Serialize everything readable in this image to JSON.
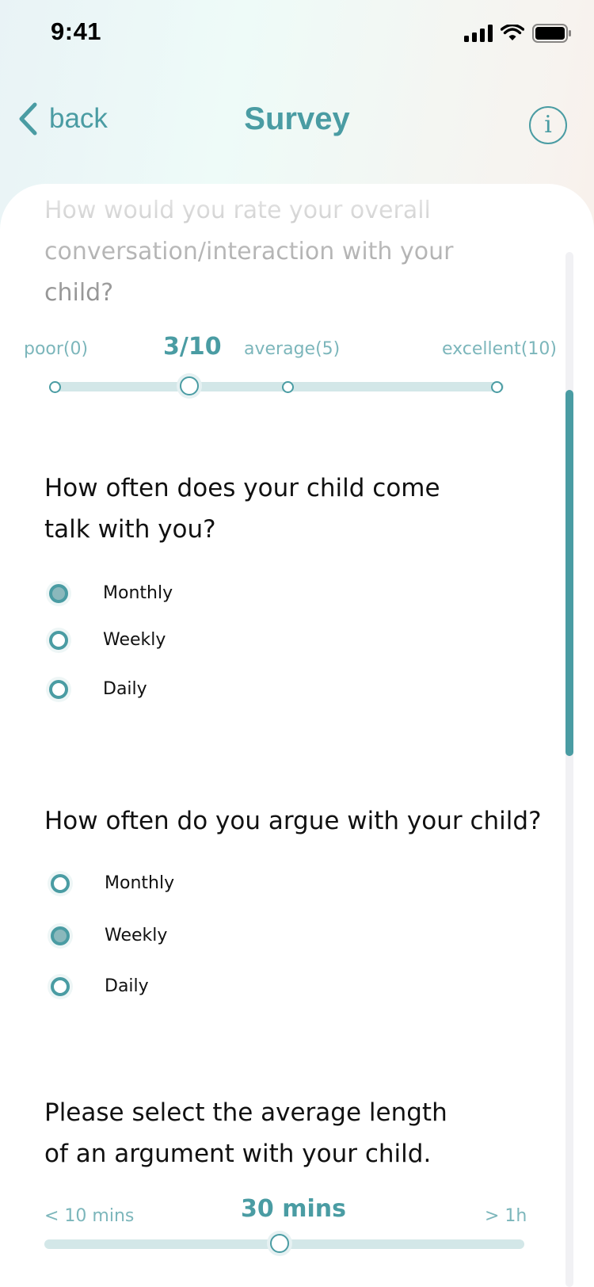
{
  "status": {
    "time": "9:41"
  },
  "nav": {
    "back_label": "back",
    "title": "Survey"
  },
  "colors": {
    "accent": "#4a9ca3",
    "track": "#d3e7e8",
    "label": "#7cb6bb"
  },
  "q1": {
    "text": "How would you rate your overall conversation/interaction with your child?",
    "labels": {
      "min": "poor(0)",
      "mid": "average(5)",
      "max": "excellent(10)"
    },
    "value_text": "3/10",
    "value": 3,
    "max": 10
  },
  "q2": {
    "text": "How often does your child come talk with you?",
    "options": [
      "Monthly",
      "Weekly",
      "Daily"
    ],
    "selected": "Monthly"
  },
  "q3": {
    "text": "How often do you argue with your child?",
    "options": [
      "Monthly",
      "Weekly",
      "Daily"
    ],
    "selected": "Weekly"
  },
  "q4": {
    "text": "Please select the average length of an argument with your child.",
    "labels": {
      "min": "< 10 mins",
      "max": "> 1h"
    },
    "value_text": "30 mins",
    "value_fraction": 0.5
  }
}
